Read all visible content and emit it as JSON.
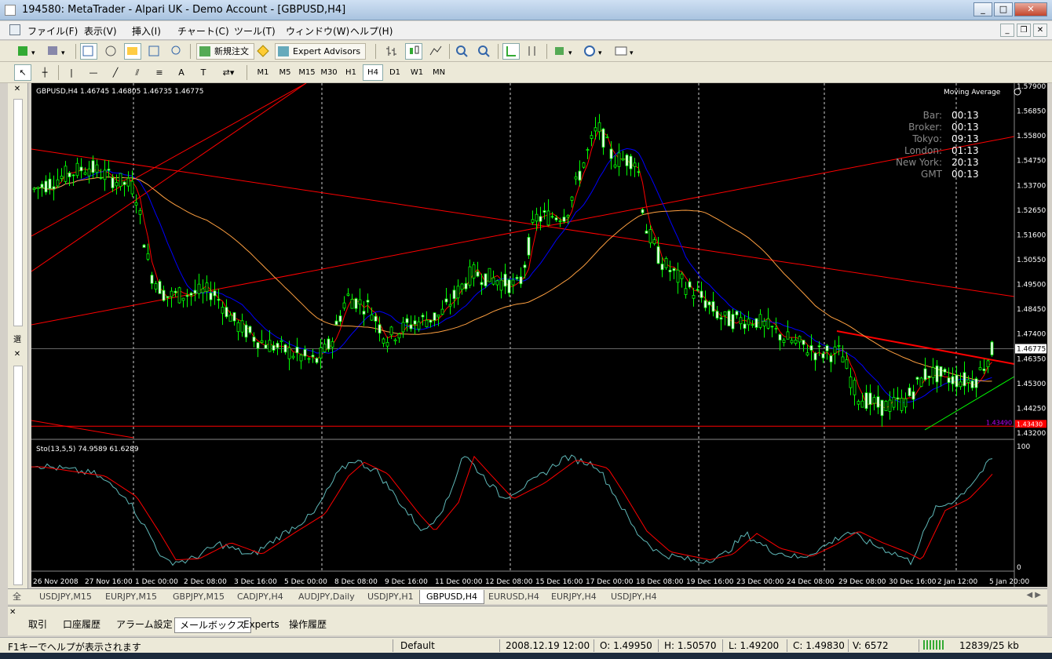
{
  "window": {
    "title": "194580: MetaTrader - Alpari UK - Demo Account - [GBPUSD,H4]"
  },
  "menu": [
    "ファイル(F)",
    "表示(V)",
    "挿入(I)",
    "チャート(C)",
    "ツール(T)",
    "ウィンドウ(W)",
    "ヘルプ(H)"
  ],
  "toolbar": {
    "new_order": "新規注文",
    "expert_advisors": "Expert Advisors"
  },
  "timeframes": [
    "M1",
    "M5",
    "M15",
    "M30",
    "H1",
    "H4",
    "D1",
    "W1",
    "MN"
  ],
  "active_timeframe": "H4",
  "chart": {
    "header": "GBPUSD,H4  1.46745 1.46805 1.46735 1.46775",
    "indicator_label": "Moving Average",
    "clock": [
      {
        "label": "Bar:",
        "time": "00:13"
      },
      {
        "label": "Broker:",
        "time": "00:13"
      },
      {
        "label": "Tokyo:",
        "time": "09:13"
      },
      {
        "label": "London:",
        "time": "01:13"
      },
      {
        "label": "New York:",
        "time": "20:13"
      },
      {
        "label": "GMT",
        "time": "00:13"
      }
    ],
    "price_ticks": [
      "1.57900",
      "1.56850",
      "1.55800",
      "1.54750",
      "1.53700",
      "1.52650",
      "1.51600",
      "1.50550",
      "1.49500",
      "1.48450",
      "1.47400",
      "1.46350",
      "1.45300",
      "1.44250",
      "1.43200"
    ],
    "current_price": "1.46775",
    "low_line_price": "1.43490",
    "low_line_tag": "1.43430",
    "stoch_header": "Sto(13,5,5) 74.9589 61.6289",
    "stoch_ticks": [
      "100",
      "0"
    ],
    "date_ticks": [
      "26 Nov 2008",
      "27 Nov 16:00",
      "1 Dec 00:00",
      "2 Dec 08:00",
      "3 Dec 16:00",
      "5 Dec 00:00",
      "8 Dec 08:00",
      "9 Dec 16:00",
      "11 Dec 00:00",
      "12 Dec 08:00",
      "15 Dec 16:00",
      "17 Dec 00:00",
      "18 Dec 08:00",
      "19 Dec 16:00",
      "23 Dec 00:00",
      "24 Dec 08:00",
      "29 Dec 08:00",
      "30 Dec 16:00",
      "2 Jan 12:00",
      "5 Jan 20:00"
    ]
  },
  "chart_tabs": [
    "USDJPY,M15",
    "EURJPY,M15",
    "GBPJPY,M15",
    "CADJPY,H4",
    "AUDJPY,Daily",
    "USDJPY,H1",
    "GBPUSD,H4",
    "EURUSD,H4",
    "EURJPY,H4",
    "USDJPY,H4"
  ],
  "active_chart_tab": "GBPUSD,H4",
  "terminal_tabs": [
    "取引",
    "口座履歴",
    "アラーム設定",
    "メールボックス",
    "Experts",
    "操作履歴"
  ],
  "active_terminal_tab": "メールボックス",
  "status": {
    "help": "F1キーでヘルプが表示されます",
    "profile": "Default",
    "datetime": "2008.12.19 12:00",
    "open": "O: 1.49950",
    "high": "H: 1.50570",
    "low": "L: 1.49200",
    "close": "C: 1.49830",
    "volume": "V: 6572",
    "traffic": "12839/25 kb"
  },
  "colors": {
    "bull": "#00ff00",
    "bear": "#ffffff",
    "ma_fast": "#ff0000",
    "ma_mid": "#0000ff",
    "ma_slow": "#ffa040",
    "stoch_main": "#5fb8b8",
    "stoch_signal": "#ff0000"
  }
}
